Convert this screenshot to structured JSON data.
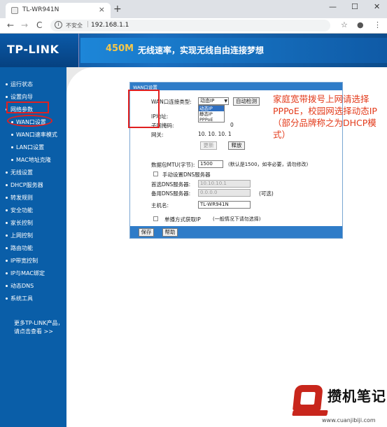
{
  "browser": {
    "tab_title": "TL-WR941N",
    "tab_close": "×",
    "new_tab": "+",
    "window_min": "—",
    "window_max": "☐",
    "window_close": "✕",
    "nav_back": "←",
    "nav_forward": "→",
    "nav_reload": "C",
    "insecure_label": "不安全",
    "url_separator": "|",
    "url": "192.168.1.1",
    "info_icon": "i",
    "icons": {
      "star": "☆",
      "account": "●",
      "menu": "⋮"
    }
  },
  "header": {
    "logo": "TP-LINK",
    "slogan_speed": "450M",
    "slogan_text": "无线速率，实现无线自由连接梦想"
  },
  "sidebar": {
    "items": [
      {
        "label": "运行状态"
      },
      {
        "label": "设置向导"
      },
      {
        "label": "网络参数"
      },
      {
        "label": "WAN口设置"
      },
      {
        "label": "WAN口速率模式"
      },
      {
        "label": "LAN口设置"
      },
      {
        "label": "MAC地址克隆"
      },
      {
        "label": "无线设置"
      },
      {
        "label": "DHCP服务器"
      },
      {
        "label": "转发规则"
      },
      {
        "label": "安全功能"
      },
      {
        "label": "家长控制"
      },
      {
        "label": "上网控制"
      },
      {
        "label": "路由功能"
      },
      {
        "label": "IP带宽控制"
      },
      {
        "label": "IP与MAC绑定"
      },
      {
        "label": "动态DNS"
      },
      {
        "label": "系统工具"
      }
    ],
    "more_line1": "更多TP-LINK产品，",
    "more_line2": "请点击查看 >>"
  },
  "panel": {
    "title": "WAN口设置",
    "wan_type_label": "WAN口连接类型:",
    "wan_type_selected": "动态IP",
    "dropdown_arrow": "▼",
    "dropdown_options": [
      "动态IP",
      "静态IP",
      "PPPoE"
    ],
    "auto_detect": "自动检测",
    "ip_label": "IP地址:",
    "mask_label": "子网掩码:",
    "mask_tail": "0",
    "gateway_label": "网关:",
    "gateway_value": "10. 10. 10. 1",
    "renew_button": "更新",
    "release_button": "释放",
    "mtu_label": "数据包MTU(字节):",
    "mtu_value": "1500",
    "mtu_hint": "(默认是1500，如非必要，请勿修改)",
    "manual_dns_label": "手动设置DNS服务器",
    "primary_dns_label": "首选DNS服务器:",
    "primary_dns_value": "10.10.10.1",
    "secondary_dns_label": "备用DNS服务器:",
    "secondary_dns_value": "0.0.0.0",
    "secondary_dns_hint": "(可选)",
    "hostname_label": "主机名:",
    "hostname_value": "TL-WR941N",
    "unicast_label": "单播方式获取IP",
    "unicast_hint": "(一般情况下请勿选择)",
    "save_button": "保存",
    "help_button": "帮助"
  },
  "annotation": {
    "text": "家庭宽带拨号上网请选择PPPoE，校园网选择动态IP（部分品牌称之为DHCP模式）"
  },
  "watermark": {
    "title": "攒机笔记",
    "url": "www.cuanjibiji.com"
  },
  "colors": {
    "sidebar_bg": "#0a5ea8",
    "panel_header": "#2f7cc8",
    "highlight_red": "#e02020",
    "annotation_red": "#e33a1a",
    "watermark_red": "#c8261c"
  }
}
